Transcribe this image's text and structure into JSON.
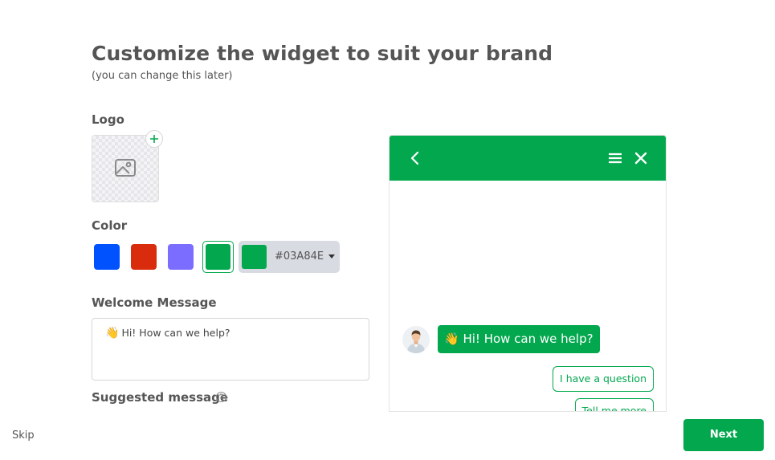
{
  "header": {
    "title": "Customize the widget to suit your brand",
    "subtitle": "(you can change this later)"
  },
  "logo": {
    "label": "Logo",
    "placeholder_icon": "image-icon",
    "add_icon": "plus-icon"
  },
  "color": {
    "label": "Color",
    "swatches": [
      "#0052FF",
      "#D92C0C",
      "#7B6DFF"
    ],
    "selected": "#03A84E",
    "hex_value": "#03A84E"
  },
  "welcome": {
    "label": "Welcome Message",
    "emoji": "👋",
    "text": "Hi! How can we help?"
  },
  "suggested": {
    "label": "Suggested message",
    "help_icon": "question-circle-icon"
  },
  "preview": {
    "accent": "#03A84E",
    "back_icon": "chevron-left-icon",
    "menu_icon": "hamburger-menu-icon",
    "close_icon": "close-icon",
    "bubble_emoji": "👋",
    "bubble_text": "Hi! How can we help?",
    "suggestions": [
      "I have a question",
      "Tell me more"
    ]
  },
  "footer": {
    "skip_label": "Skip",
    "next_label": "Next"
  }
}
